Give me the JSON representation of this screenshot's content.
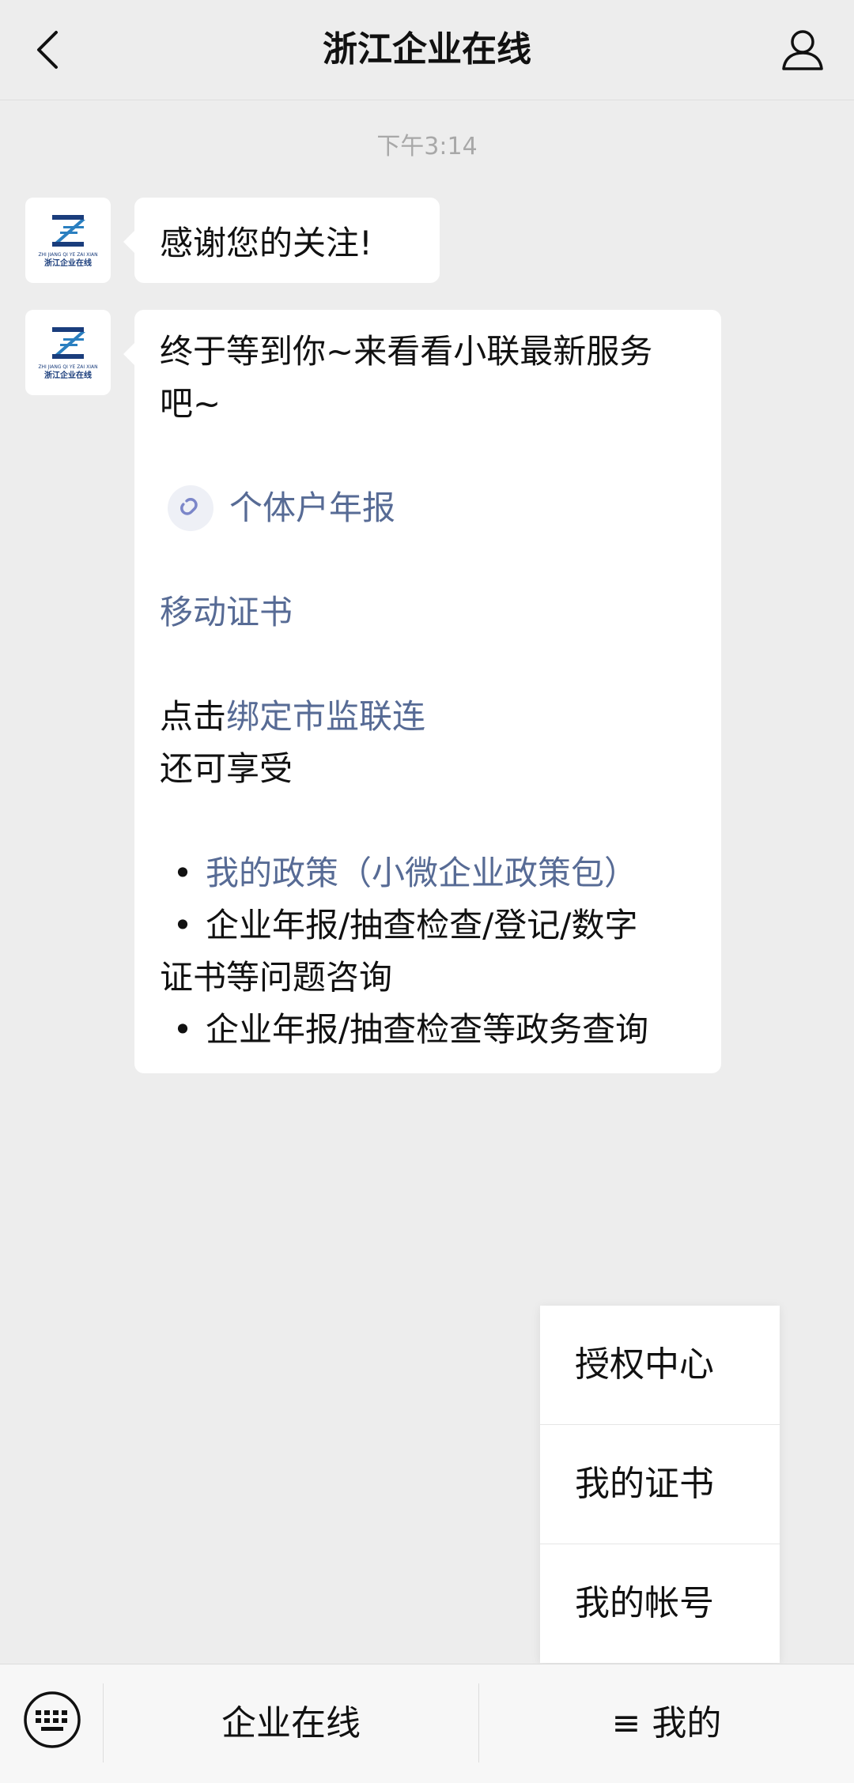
{
  "header": {
    "title": "浙江企业在线"
  },
  "chat": {
    "timestamp": "下午3:14",
    "msg1": "感谢您的关注!",
    "msg2": {
      "line1": "终于等到你~来看看小联最新服务",
      "line2": "吧~",
      "mini_link": "个体户年报",
      "link_cert": "移动证书",
      "bind_prefix": "点击",
      "bind_link": "绑定市监联连",
      "also": "还可享受",
      "bullet1": "我的政策（小微企业政策包）",
      "bullet2_a": "企业年报/抽查检查/登记/数字",
      "bullet2_b": "证书等问题咨询",
      "bullet3": "企业年报/抽查检查等政务查询"
    }
  },
  "popup_menu": {
    "items": [
      "授权中心",
      "我的证书",
      "我的帐号"
    ]
  },
  "bottom_bar": {
    "menu1": "企业在线",
    "menu2": "≡ 我的"
  },
  "avatar": {
    "logo_sub": "ZHI JIANG QI YE ZAI XIAN",
    "logo_text": "浙江企业在线"
  },
  "colors": {
    "link": "#576b95",
    "background": "#ededed",
    "bubble": "#ffffff",
    "logo_blue": "#2a7fc0",
    "logo_navy": "#1a3d7c"
  },
  "icons": {
    "back": "chevron-left-icon",
    "profile": "user-icon",
    "mini": "link-icon",
    "keyboard": "keyboard-icon"
  }
}
